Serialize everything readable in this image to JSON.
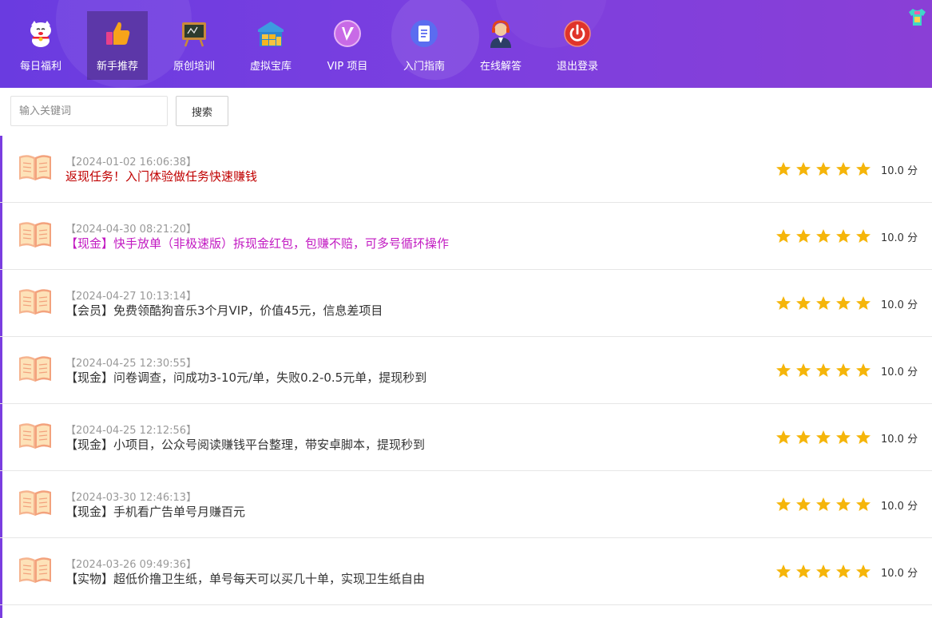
{
  "nav": {
    "items": [
      {
        "label": "每日福利",
        "icon": "lucky-cat-icon",
        "active": false
      },
      {
        "label": "新手推荐",
        "icon": "thumbs-up-icon",
        "active": true
      },
      {
        "label": "原创培训",
        "icon": "chalkboard-icon",
        "active": false
      },
      {
        "label": "虚拟宝库",
        "icon": "warehouse-icon",
        "active": false
      },
      {
        "label": "VIP 项目",
        "icon": "vip-icon",
        "active": false
      },
      {
        "label": "入门指南",
        "icon": "guide-document-icon",
        "active": false
      },
      {
        "label": "在线解答",
        "icon": "support-agent-icon",
        "active": false
      },
      {
        "label": "退出登录",
        "icon": "power-icon",
        "active": false
      }
    ],
    "corner_icon": "tshirt-icon"
  },
  "search": {
    "placeholder": "输入关键词",
    "value": "",
    "button_label": "搜索"
  },
  "list": {
    "items": [
      {
        "date": "【2024-01-02 16:06:38】",
        "title": "返现任务！入门体验做任务快速赚钱",
        "title_color": "#c00000",
        "rating": 5,
        "score": "10.0 分"
      },
      {
        "date": "【2024-04-30 08:21:20】",
        "title": "【现金】快手放单（非极速版）拆现金红包，包赚不赔，可多号循环操作",
        "title_color": "#c21ac2",
        "rating": 5,
        "score": "10.0 分"
      },
      {
        "date": "【2024-04-27 10:13:14】",
        "title": "【会员】免费领酷狗音乐3个月VIP，价值45元，信息差项目",
        "title_color": "#333333",
        "rating": 5,
        "score": "10.0 分"
      },
      {
        "date": "【2024-04-25 12:30:55】",
        "title": "【现金】问卷调查，问成功3-10元/单，失败0.2-0.5元单，提现秒到",
        "title_color": "#333333",
        "rating": 5,
        "score": "10.0 分"
      },
      {
        "date": "【2024-04-25 12:12:56】",
        "title": "【现金】小项目，公众号阅读赚钱平台整理，带安卓脚本，提现秒到",
        "title_color": "#333333",
        "rating": 5,
        "score": "10.0 分"
      },
      {
        "date": "【2024-03-30 12:46:13】",
        "title": "【现金】手机看广告单号月赚百元",
        "title_color": "#333333",
        "rating": 5,
        "score": "10.0 分"
      },
      {
        "date": "【2024-03-26 09:49:36】",
        "title": "【实物】超低价撸卫生纸，单号每天可以买几十单，实现卫生纸自由",
        "title_color": "#333333",
        "rating": 5,
        "score": "10.0 分"
      }
    ]
  },
  "colors": {
    "accent": "#7a3de0",
    "star": "#f5b50a",
    "book": "#f2a07a"
  }
}
